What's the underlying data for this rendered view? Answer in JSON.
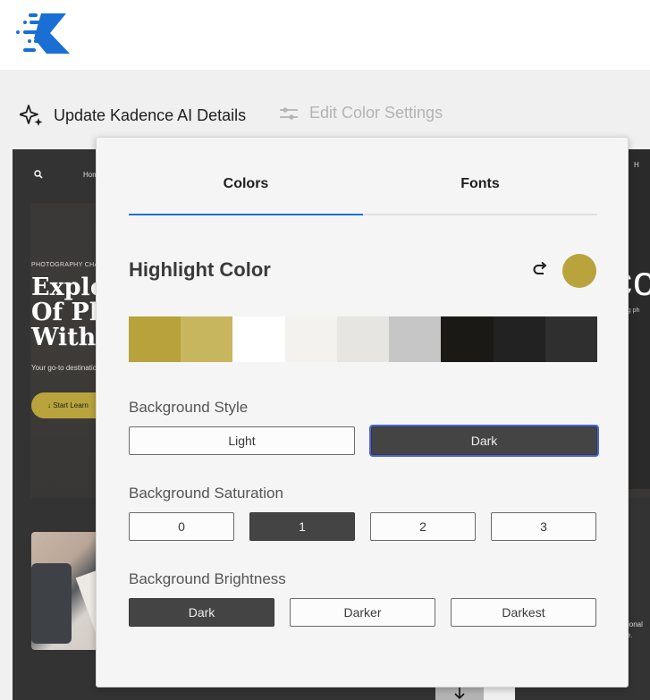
{
  "header": {
    "logo": "kadence-logo-icon"
  },
  "toolbar": {
    "update_ai_label": "Update Kadence AI Details",
    "update_ai_icon": "sparkles-icon",
    "edit_color_label": "Edit Color Settings",
    "edit_color_icon": "sliders-icon"
  },
  "preview": {
    "nav_home": "Hom",
    "eyebrow": "PHOTOGRAPHY CHAMP",
    "hero_line1": "Explo",
    "hero_line2": "Of Ph",
    "hero_line3": "With U",
    "hero_sub": "Your go-to destinatio",
    "cta_label": "↓  Start Learn",
    "right_nav": "H",
    "right_big": "co",
    "right_sub": "ring ph",
    "right_p1": "ssional",
    "right_p2": "me."
  },
  "popup": {
    "tabs": [
      {
        "label": "Colors",
        "active": true
      },
      {
        "label": "Fonts",
        "active": false
      }
    ],
    "highlight": {
      "title": "Highlight Color",
      "reset_icon": "redo-arrow-icon",
      "current_color": "#b8a33c"
    },
    "palette": [
      "#b7a23c",
      "#c8b65e",
      "#ffffff",
      "#f3f2ef",
      "#e6e5e2",
      "#c6c6c6",
      "#1a1915",
      "#222222",
      "#2f2f2f"
    ],
    "background_style": {
      "label": "Background Style",
      "options": [
        "Light",
        "Dark"
      ],
      "selected": "Dark"
    },
    "background_saturation": {
      "label": "Background Saturation",
      "options": [
        "0",
        "1",
        "2",
        "3"
      ],
      "selected": "1"
    },
    "background_brightness": {
      "label": "Background Brightness",
      "options": [
        "Dark",
        "Darker",
        "Darkest"
      ],
      "selected": "Dark"
    }
  }
}
